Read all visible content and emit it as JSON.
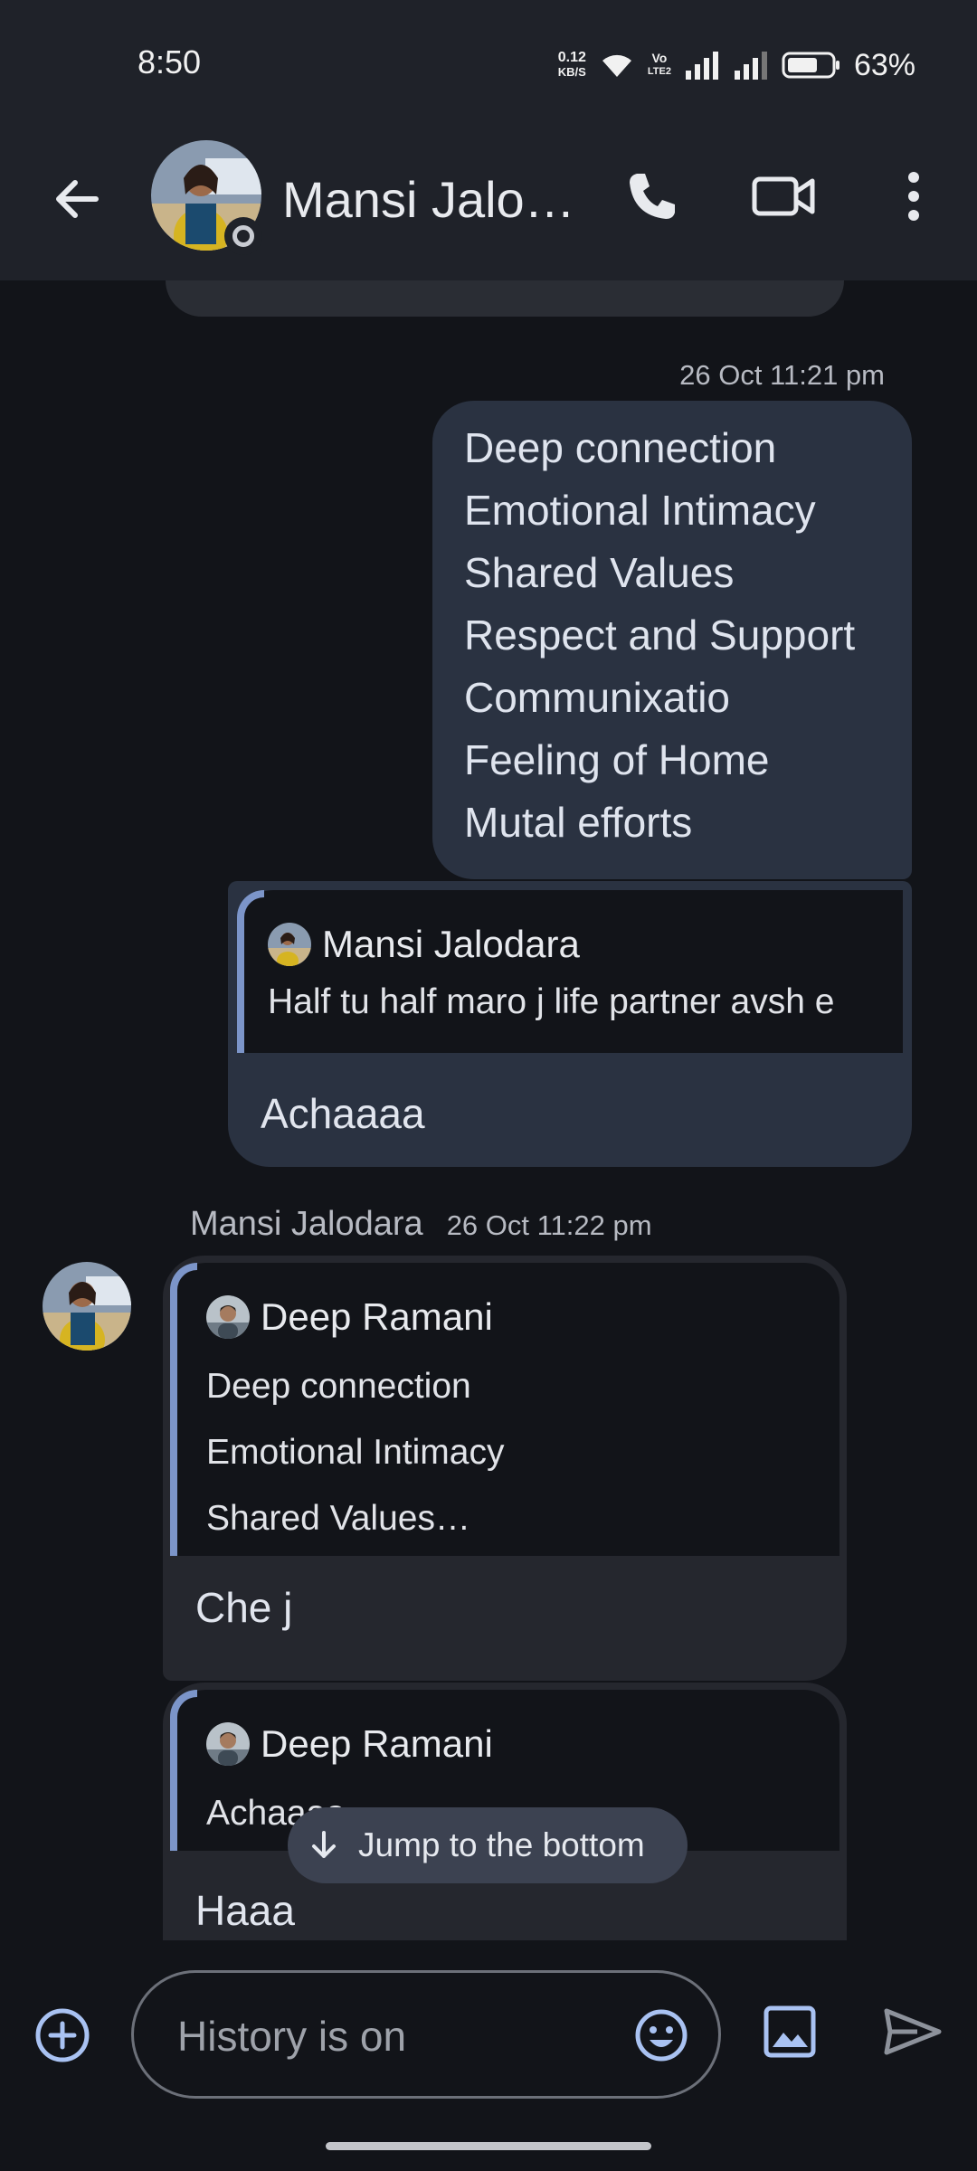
{
  "status_bar": {
    "time": "8:50",
    "net_speed_value": "0.12",
    "net_speed_unit": "KB/S",
    "volte_top": "Vo",
    "volte_bottom": "LTE2",
    "battery_percent": "63%",
    "icons": [
      "wifi-icon",
      "volte-icon",
      "signal-icon",
      "signal-icon",
      "battery-icon"
    ]
  },
  "header": {
    "contact_name": "Mansi Jalo…",
    "icons": [
      "back-arrow-icon",
      "phone-icon",
      "video-camera-icon",
      "more-vert-icon"
    ]
  },
  "messages": {
    "outgoing_timestamp": "26 Oct 11:21 pm",
    "outgoing_lines": [
      "Deep connection",
      "Emotional Intimacy",
      "Shared Values",
      "Respect and Support",
      "Communixatio",
      "Feeling of Home",
      "Mutal efforts"
    ],
    "outgoing_reply": {
      "quoted_name": "Mansi Jalodara",
      "quoted_text": "Half tu half maro j life partner avsh e",
      "body": "Achaaaa"
    },
    "incoming_sender": "Mansi Jalodara",
    "incoming_timestamp": "26 Oct 11:22 pm",
    "incoming_reply_1": {
      "quoted_name": "Deep Ramani",
      "quoted_lines": [
        "Deep connection",
        "Emotional Intimacy",
        "Shared Values…"
      ],
      "body": "Che j"
    },
    "incoming_reply_2": {
      "quoted_name": "Deep Ramani",
      "quoted_text": "Achaaaa",
      "body": "Haaa"
    }
  },
  "jump_button": {
    "label": "Jump to the bottom"
  },
  "composer": {
    "placeholder": "History is on",
    "icons": [
      "add-circle-icon",
      "emoji-icon",
      "image-icon",
      "send-icon"
    ]
  },
  "colors": {
    "background": "#121419",
    "header": "#1f2229",
    "outgoing_bubble": "#2a3241",
    "incoming_bubble": "#25272e",
    "quote_accent": "#7c95c9"
  }
}
